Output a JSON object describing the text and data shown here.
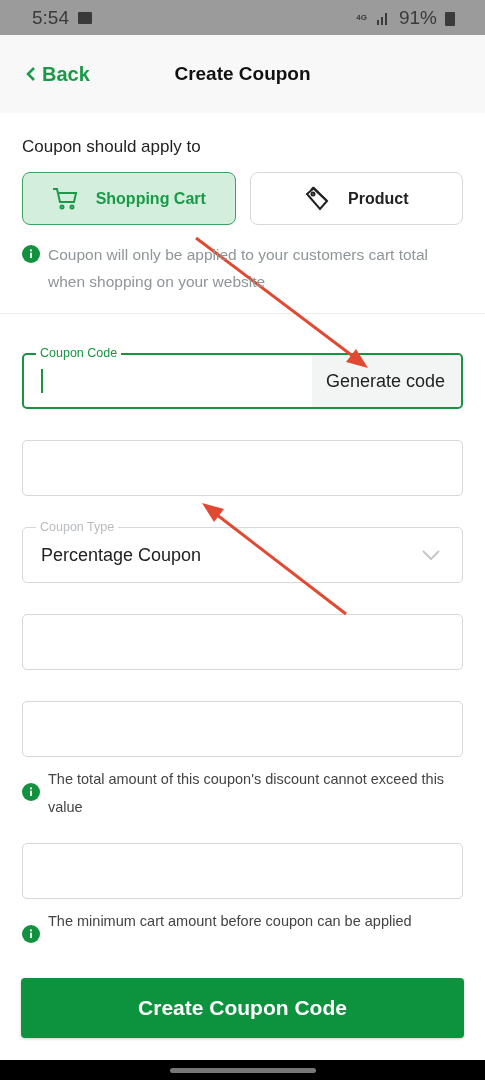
{
  "status_bar": {
    "time": "5:54",
    "network": "4G",
    "battery": "91%"
  },
  "header": {
    "back": "Back",
    "title": "Create Coupon"
  },
  "apply_to": {
    "label": "Coupon should apply to",
    "options": [
      {
        "label": "Shopping Cart",
        "kind": "cart",
        "selected": true
      },
      {
        "label": "Product",
        "kind": "tag",
        "selected": false
      }
    ],
    "hint": "Coupon will only be applied to your customers cart total when shopping on your website"
  },
  "fields": [
    {
      "kind": "text",
      "label": "Coupon Code",
      "focused": true,
      "action": "Generate code"
    },
    {
      "kind": "text",
      "focused": false
    },
    {
      "kind": "select",
      "label": "Coupon Type",
      "value": "Percentage Coupon",
      "focused": false
    },
    {
      "kind": "text",
      "focused": false
    },
    {
      "kind": "text",
      "focused": false,
      "hint": "The total amount of this coupon's discount cannot exceed this value"
    },
    {
      "kind": "text",
      "focused": false,
      "hint": "The minimum cart amount before coupon can be applied"
    }
  ],
  "submit": "Create Coupon Code"
}
